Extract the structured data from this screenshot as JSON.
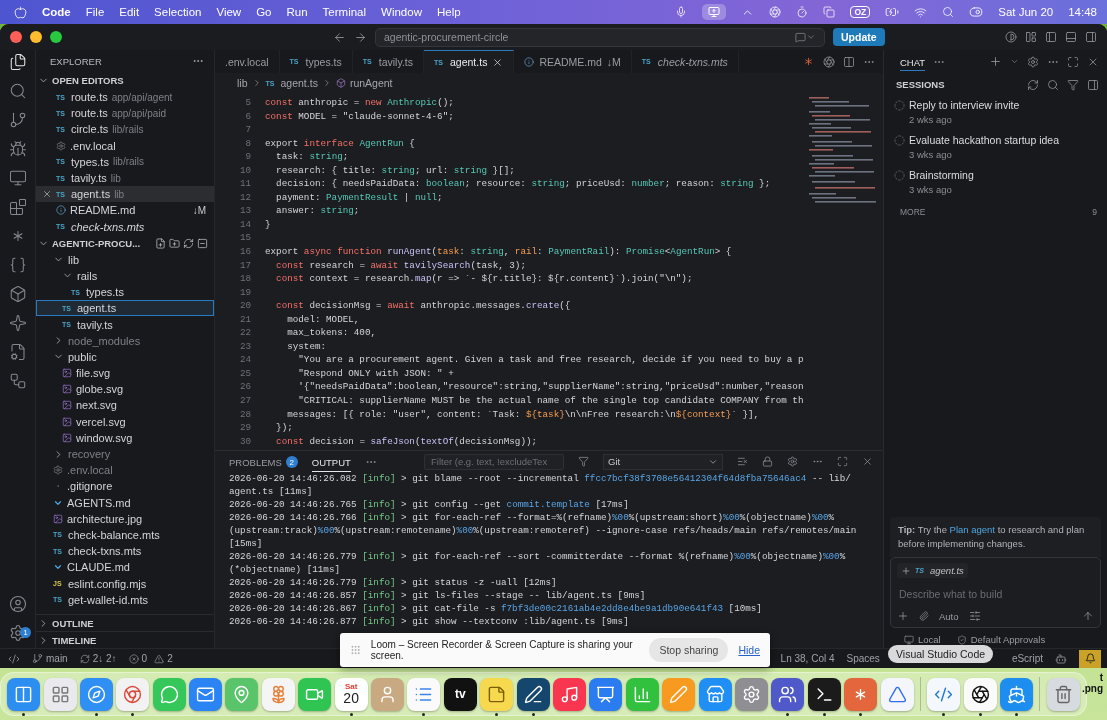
{
  "menubar": {
    "app": "Code",
    "menus": [
      "File",
      "Edit",
      "Selection",
      "View",
      "Go",
      "Run",
      "Terminal",
      "Window",
      "Help"
    ],
    "status_badge": "OZ",
    "date": "Sat Jun 20",
    "time": "14:48"
  },
  "titlebar": {
    "search": "agentic-procurement-circle",
    "update_button": "Update"
  },
  "activity_bar": {
    "items": [
      {
        "kind": "files",
        "selected": true
      },
      {
        "kind": "search",
        "selected": false
      },
      {
        "kind": "branch",
        "selected": false
      },
      {
        "kind": "bug",
        "selected": false
      },
      {
        "kind": "monitor",
        "selected": false
      },
      {
        "kind": "blocks",
        "selected": false
      },
      {
        "kind": "asterisk",
        "selected": false
      },
      {
        "kind": "braces",
        "selected": false
      },
      {
        "kind": "box",
        "selected": false
      },
      {
        "kind": "sparkle",
        "selected": false
      },
      {
        "kind": "filegear",
        "selected": false
      },
      {
        "kind": "workflow",
        "selected": false
      }
    ],
    "settings_badge": "1"
  },
  "explorer": {
    "title": "EXPLORER",
    "open_editors_title": "OPEN EDITORS",
    "open_editors": [
      {
        "kind": "ts",
        "icon_text": "TS",
        "name": "route.ts",
        "path": "app/api/agent",
        "italic": false,
        "selected": false
      },
      {
        "kind": "ts",
        "icon_text": "TS",
        "name": "route.ts",
        "path": "app/api/paid",
        "italic": false,
        "selected": false
      },
      {
        "kind": "ts",
        "icon_text": "TS",
        "name": "circle.ts",
        "path": "lib/rails",
        "italic": false,
        "selected": false
      },
      {
        "kind": "gear",
        "name": ".env.local",
        "italic": false,
        "selected": false
      },
      {
        "kind": "ts",
        "icon_text": "TS",
        "name": "types.ts",
        "path": "lib/rails",
        "italic": false,
        "selected": false
      },
      {
        "kind": "ts",
        "icon_text": "TS",
        "name": "tavily.ts",
        "path": "lib",
        "italic": false,
        "selected": false
      },
      {
        "kind": "ts",
        "icon_text": "TS",
        "name": "agent.ts",
        "path": "lib",
        "italic": false,
        "selected": true
      },
      {
        "kind": "info",
        "name": "README.md",
        "badge": "↓M",
        "italic": false,
        "selected": false
      },
      {
        "kind": "ts",
        "icon_text": "TS",
        "name": "check-txns.mts",
        "italic": true,
        "selected": false
      }
    ],
    "project_title": "AGENTIC-PROCU...",
    "tree": [
      {
        "kind": "folder",
        "name": "lib",
        "expanded": true,
        "dimmed": false,
        "selected": false,
        "children": [
          {
            "kind": "folder",
            "name": "rails",
            "expanded": true,
            "dimmed": false,
            "selected": false,
            "children": [
              {
                "kind": "ts",
                "icon_text": "TS",
                "name": "types.ts",
                "dimmed": false,
                "selected": false
              }
            ]
          },
          {
            "kind": "ts",
            "icon_text": "TS",
            "name": "agent.ts",
            "dimmed": false,
            "selected": true
          },
          {
            "kind": "ts",
            "icon_text": "TS",
            "name": "tavily.ts",
            "dimmed": false,
            "selected": false
          }
        ]
      },
      {
        "kind": "folder",
        "name": "node_modules",
        "expanded": false,
        "dimmed": true,
        "selected": false
      },
      {
        "kind": "folder",
        "name": "public",
        "expanded": true,
        "dimmed": false,
        "selected": false,
        "children": [
          {
            "kind": "svg",
            "name": "file.svg",
            "dimmed": false,
            "selected": false
          },
          {
            "kind": "svg",
            "name": "globe.svg",
            "dimmed": false,
            "selected": false
          },
          {
            "kind": "svg",
            "name": "next.svg",
            "dimmed": false,
            "selected": false
          },
          {
            "kind": "svg",
            "name": "vercel.svg",
            "dimmed": false,
            "selected": false
          },
          {
            "kind": "svg",
            "name": "window.svg",
            "dimmed": false,
            "selected": false
          }
        ]
      },
      {
        "kind": "folder",
        "name": "recovery",
        "expanded": false,
        "dimmed": true,
        "selected": false
      },
      {
        "kind": "gear",
        "name": ".env.local",
        "dimmed": true,
        "selected": false
      },
      {
        "kind": "git",
        "name": ".gitignore",
        "dimmed": false,
        "selected": false
      },
      {
        "kind": "md",
        "name": "AGENTS.md",
        "dimmed": false,
        "selected": false
      },
      {
        "kind": "image",
        "name": "architecture.jpg",
        "dimmed": false,
        "selected": false
      },
      {
        "kind": "ts",
        "icon_text": "TS",
        "name": "check-balance.mts",
        "dimmed": false,
        "selected": false
      },
      {
        "kind": "ts",
        "icon_text": "TS",
        "name": "check-txns.mts",
        "dimmed": false,
        "selected": false
      },
      {
        "kind": "md",
        "name": "CLAUDE.md",
        "dimmed": false,
        "selected": false
      },
      {
        "kind": "js",
        "icon_text": "JS",
        "name": "eslint.config.mjs",
        "dimmed": false,
        "selected": false
      },
      {
        "kind": "ts",
        "icon_text": "TS",
        "name": "get-wallet-id.mts",
        "dimmed": false,
        "selected": false
      }
    ],
    "sections": [
      "OUTLINE",
      "TIMELINE"
    ]
  },
  "tabs": [
    {
      "kind": "none",
      "label": ".env.local",
      "italic": false,
      "selected": false
    },
    {
      "kind": "ts",
      "icon_text": "TS",
      "label": "types.ts",
      "italic": false,
      "selected": false
    },
    {
      "kind": "ts",
      "icon_text": "TS",
      "label": "tavily.ts",
      "italic": false,
      "selected": false
    },
    {
      "kind": "ts",
      "icon_text": "TS",
      "label": "agent.ts",
      "italic": false,
      "selected": true
    },
    {
      "kind": "info",
      "label": "README.md",
      "badge": "↓M",
      "italic": false,
      "selected": false
    },
    {
      "kind": "ts",
      "icon_text": "TS",
      "label": "check-txns.mts",
      "italic": true,
      "selected": false
    }
  ],
  "breadcrumb": {
    "folder": "lib",
    "file_icon_text": "TS",
    "file": "agent.ts",
    "symbol": "runAgent"
  },
  "code": [
    {
      "number": "5",
      "segments": [
        {
          "kind": "kw",
          "text": "const "
        },
        {
          "kind": "x",
          "text": "anthropic = "
        },
        {
          "kind": "kw",
          "text": "new "
        },
        {
          "kind": "type",
          "text": "Anthropic"
        },
        {
          "kind": "x",
          "text": "();"
        }
      ]
    },
    {
      "number": "6",
      "segments": [
        {
          "kind": "kw",
          "text": "const "
        },
        {
          "kind": "x",
          "text": "MODEL = \"claude-sonnet-4-6\";"
        }
      ]
    },
    {
      "number": "7"
    },
    {
      "number": "8",
      "segments": [
        {
          "kind": "x",
          "text": "export "
        },
        {
          "kind": "kw",
          "text": "interface "
        },
        {
          "kind": "type",
          "text": "AgentRun"
        },
        {
          "kind": "x",
          "text": " {"
        }
      ]
    },
    {
      "number": "9",
      "segments": [
        {
          "kind": "x",
          "text": "  task: "
        },
        {
          "kind": "type",
          "text": "string"
        },
        {
          "kind": "x",
          "text": ";"
        }
      ]
    },
    {
      "number": "10",
      "segments": [
        {
          "kind": "x",
          "text": "  research: { title: "
        },
        {
          "kind": "type",
          "text": "string"
        },
        {
          "kind": "x",
          "text": "; url: "
        },
        {
          "kind": "type",
          "text": "string"
        },
        {
          "kind": "x",
          "text": " }[];"
        }
      ]
    },
    {
      "number": "11",
      "segments": [
        {
          "kind": "x",
          "text": "  decision: { needsPaidData: "
        },
        {
          "kind": "type",
          "text": "boolean"
        },
        {
          "kind": "x",
          "text": "; resource: "
        },
        {
          "kind": "type",
          "text": "string"
        },
        {
          "kind": "x",
          "text": "; priceUsd: "
        },
        {
          "kind": "type",
          "text": "number"
        },
        {
          "kind": "x",
          "text": "; reason: "
        },
        {
          "kind": "type",
          "text": "string"
        },
        {
          "kind": "x",
          "text": " };"
        }
      ]
    },
    {
      "number": "12",
      "segments": [
        {
          "kind": "x",
          "text": "  payment: "
        },
        {
          "kind": "type",
          "text": "PaymentResult"
        },
        {
          "kind": "x",
          "text": " | "
        },
        {
          "kind": "type",
          "text": "null"
        },
        {
          "kind": "x",
          "text": ";"
        }
      ]
    },
    {
      "number": "13",
      "segments": [
        {
          "kind": "x",
          "text": "  answer: "
        },
        {
          "kind": "type",
          "text": "string"
        },
        {
          "kind": "x",
          "text": ";"
        }
      ]
    },
    {
      "number": "14",
      "segments": [
        {
          "kind": "x",
          "text": "}"
        }
      ]
    },
    {
      "number": "15"
    },
    {
      "number": "16",
      "segments": [
        {
          "kind": "x",
          "text": "export "
        },
        {
          "kind": "kw",
          "text": "async function "
        },
        {
          "kind": "fn",
          "text": "runAgent"
        },
        {
          "kind": "x",
          "text": "("
        },
        {
          "kind": "param",
          "text": "task"
        },
        {
          "kind": "x",
          "text": ": "
        },
        {
          "kind": "type",
          "text": "string"
        },
        {
          "kind": "x",
          "text": ", "
        },
        {
          "kind": "param",
          "text": "rail"
        },
        {
          "kind": "x",
          "text": ": "
        },
        {
          "kind": "type",
          "text": "PaymentRail"
        },
        {
          "kind": "x",
          "text": "): "
        },
        {
          "kind": "type",
          "text": "Promise"
        },
        {
          "kind": "x",
          "text": "<"
        },
        {
          "kind": "type",
          "text": "AgentRun"
        },
        {
          "kind": "x",
          "text": "> {"
        }
      ]
    },
    {
      "number": "17",
      "segments": [
        {
          "kind": "kw",
          "text": "  const "
        },
        {
          "kind": "x",
          "text": "research = "
        },
        {
          "kind": "kw",
          "text": "await "
        },
        {
          "kind": "fn",
          "text": "tavilySearch"
        },
        {
          "kind": "x",
          "text": "(task, 3);"
        }
      ]
    },
    {
      "number": "18",
      "segments": [
        {
          "kind": "kw",
          "text": "  const "
        },
        {
          "kind": "x",
          "text": "context = research."
        },
        {
          "kind": "fn",
          "text": "map"
        },
        {
          "kind": "x",
          "text": "(r => `- ${r.title}: ${r.content}`).join(\"\\n\");"
        }
      ]
    },
    {
      "number": "19"
    },
    {
      "number": "20",
      "segments": [
        {
          "kind": "kw",
          "text": "  const "
        },
        {
          "kind": "x",
          "text": "decisionMsg = "
        },
        {
          "kind": "kw",
          "text": "await "
        },
        {
          "kind": "x",
          "text": "anthropic.messages."
        },
        {
          "kind": "fn",
          "text": "create"
        },
        {
          "kind": "x",
          "text": "({"
        }
      ]
    },
    {
      "number": "21",
      "segments": [
        {
          "kind": "x",
          "text": "    model: MODEL,"
        }
      ]
    },
    {
      "number": "22",
      "segments": [
        {
          "kind": "x",
          "text": "    max_tokens: 400,"
        }
      ]
    },
    {
      "number": "23",
      "segments": [
        {
          "kind": "x",
          "text": "    system:"
        }
      ]
    },
    {
      "number": "24",
      "segments": [
        {
          "kind": "x",
          "text": "      \"You are a procurement agent. Given a task and free research, decide if you need to buy a p"
        }
      ]
    },
    {
      "number": "25",
      "segments": [
        {
          "kind": "x",
          "text": "      \"Respond ONLY with JSON: \" +"
        }
      ]
    },
    {
      "number": "26",
      "segments": [
        {
          "kind": "x",
          "text": "      '{\"needsPaidData\":boolean,\"resource\":string,\"supplierName\":string,\"priceUsd\":number,\"reason"
        }
      ]
    },
    {
      "number": "27",
      "segments": [
        {
          "kind": "x",
          "text": "      \"CRITICAL: supplierName MUST be the actual name of the single top candidate COMPANY from th"
        }
      ]
    },
    {
      "number": "28",
      "segments": [
        {
          "kind": "x",
          "text": "    messages: [{ role: \"user\", content: `Task: "
        },
        {
          "kind": "param",
          "text": "${task}"
        },
        {
          "kind": "x",
          "text": "\\n\\nFree research:\\n"
        },
        {
          "kind": "param",
          "text": "${context}"
        },
        {
          "kind": "x",
          "text": "` }],"
        }
      ]
    },
    {
      "number": "29",
      "segments": [
        {
          "kind": "x",
          "text": "  });"
        }
      ]
    },
    {
      "number": "30",
      "segments": [
        {
          "kind": "kw",
          "text": "  const "
        },
        {
          "kind": "x",
          "text": "decision = "
        },
        {
          "kind": "fn",
          "text": "safeJson"
        },
        {
          "kind": "x",
          "text": "("
        },
        {
          "kind": "fn",
          "text": "textOf"
        },
        {
          "kind": "x",
          "text": "(decisionMsg));"
        }
      ]
    }
  ],
  "panel": {
    "tabs": [
      {
        "label": "PROBLEMS",
        "badge": "2",
        "selected": false
      },
      {
        "label": "OUTPUT",
        "selected": true
      }
    ],
    "filter_placeholder": "Filter (e.g. text, !excludeTex",
    "channel": "Git",
    "lines": [
      [
        {
          "kind": "x",
          "text": "2026-06-20 14:46:26.082 "
        },
        {
          "kind": "info",
          "text": "[info]"
        },
        {
          "kind": "x",
          "text": " > git blame --root --incremental "
        },
        {
          "kind": "link",
          "text": "ffcc7bcf38f3708e56412304f64d8fba75646ac4"
        },
        {
          "kind": "x",
          "text": " -- lib/"
        }
      ],
      [
        {
          "kind": "x",
          "text": "agent.ts [11ms]"
        }
      ],
      [
        {
          "kind": "x",
          "text": "2026-06-20 14:46:26.765 "
        },
        {
          "kind": "info",
          "text": "[info]"
        },
        {
          "kind": "x",
          "text": " > git config --get "
        },
        {
          "kind": "link",
          "text": "commit.template"
        },
        {
          "kind": "x",
          "text": " [17ms]"
        }
      ],
      [
        {
          "kind": "x",
          "text": "2026-06-20 14:46:26.766 "
        },
        {
          "kind": "info",
          "text": "[info]"
        },
        {
          "kind": "x",
          "text": " > git for-each-ref --format=%(refname)"
        },
        {
          "kind": "link",
          "text": "%00"
        },
        {
          "kind": "x",
          "text": "%(upstream:short)"
        },
        {
          "kind": "link",
          "text": "%00"
        },
        {
          "kind": "x",
          "text": "%(objectname)"
        },
        {
          "kind": "link",
          "text": "%00"
        },
        {
          "kind": "x",
          "text": "%"
        }
      ],
      [
        {
          "kind": "x",
          "text": "(upstream:track)"
        },
        {
          "kind": "link",
          "text": "%00"
        },
        {
          "kind": "x",
          "text": "%(upstream:remotename)"
        },
        {
          "kind": "link",
          "text": "%00"
        },
        {
          "kind": "x",
          "text": "%(upstream:remoteref) --ignore-case refs/heads/main refs/remotes/main"
        }
      ],
      [
        {
          "kind": "x",
          "text": "[15ms]"
        }
      ],
      [
        {
          "kind": "x",
          "text": "2026-06-20 14:46:26.779 "
        },
        {
          "kind": "info",
          "text": "[info]"
        },
        {
          "kind": "x",
          "text": " > git for-each-ref --sort -committerdate --format %(refname)"
        },
        {
          "kind": "link",
          "text": "%00"
        },
        {
          "kind": "x",
          "text": "%(objectname)"
        },
        {
          "kind": "link",
          "text": "%00"
        },
        {
          "kind": "x",
          "text": "%"
        }
      ],
      [
        {
          "kind": "x",
          "text": "(*objectname) [11ms]"
        }
      ],
      [
        {
          "kind": "x",
          "text": "2026-06-20 14:46:26.779 "
        },
        {
          "kind": "info",
          "text": "[info]"
        },
        {
          "kind": "x",
          "text": " > git status -z -uall [12ms]"
        }
      ],
      [
        {
          "kind": "x",
          "text": "2026-06-20 14:46:26.857 "
        },
        {
          "kind": "info",
          "text": "[info]"
        },
        {
          "kind": "x",
          "text": " > git ls-files --stage -- lib/agent.ts [9ms]"
        }
      ],
      [
        {
          "kind": "x",
          "text": "2026-06-20 14:46:26.867 "
        },
        {
          "kind": "info",
          "text": "[info]"
        },
        {
          "kind": "x",
          "text": " > git cat-file -s "
        },
        {
          "kind": "link",
          "text": "f7bf3de00c2161ab4e2dd8e4be9a1db90e641f43"
        },
        {
          "kind": "x",
          "text": " [10ms]"
        }
      ],
      [
        {
          "kind": "x",
          "text": "2026-06-20 14:46:26.877 "
        },
        {
          "kind": "info",
          "text": "[info]"
        },
        {
          "kind": "x",
          "text": " > git show --textconv :lib/agent.ts [9ms]"
        }
      ]
    ]
  },
  "chat": {
    "tab": "CHAT",
    "sessions_title": "SESSIONS",
    "sessions": [
      {
        "title": "Reply to interview invite",
        "time": "2 wks ago"
      },
      {
        "title": "Evaluate hackathon startup idea",
        "time": "3 wks ago"
      },
      {
        "title": "Brainstorming",
        "time": "3 wks ago"
      }
    ],
    "more": "MORE",
    "more_count": "9",
    "tip": {
      "before": "**Tip:** Try the",
      "link": "Plan agent",
      "after": "to research and plan before implementing changes."
    },
    "attachment_icon_text": "TS",
    "attachment": "agent.ts",
    "placeholder": "Describe what to build",
    "mode": "Auto",
    "location": "Local",
    "approvals": "Default Approvals"
  },
  "status_bar": {
    "branch": "main",
    "sync": "2↓ 2↑",
    "errors": "0",
    "warnings": "2",
    "position": "Ln 38, Col 4",
    "spaces": "Spaces",
    "language": "eScript"
  },
  "loom": {
    "message": "Loom – Screen Recorder & Screen Capture is sharing your screen.",
    "stop_button": "Stop sharing",
    "hide_link": "Hide"
  },
  "tooltip": "Visual Studio Code",
  "desktop_file": {
    "lines": [
      "t",
      ".png"
    ]
  },
  "dock": [
    {
      "kind": "finder",
      "color": "#2b8ef0",
      "running": true
    },
    {
      "kind": "grid",
      "color": "#e9e9ee",
      "running": false
    },
    {
      "kind": "compass",
      "color": "#2f8ff5",
      "running": true
    },
    {
      "kind": "chrome",
      "color": "#f2f2f2",
      "running": true
    },
    {
      "kind": "chat",
      "color": "#35c759",
      "running": false
    },
    {
      "kind": "mail",
      "color": "#2a84f3",
      "running": false
    },
    {
      "kind": "map",
      "color": "#5ac46b",
      "running": false
    },
    {
      "kind": "flower",
      "color": "#f5f5f5",
      "running": false
    },
    {
      "kind": "video",
      "color": "#30c552",
      "running": false
    },
    {
      "kind": "calendar",
      "color": "#ffffff",
      "running": true,
      "weekday": "Sat",
      "day": "20"
    },
    {
      "kind": "person",
      "color": "#c9a981",
      "running": false
    },
    {
      "kind": "list",
      "color": "#fafafa",
      "running": true
    },
    {
      "kind": "tv",
      "color": "#111111",
      "running": false,
      "label": "tv"
    },
    {
      "kind": "note",
      "color": "#f7d950",
      "running": true
    },
    {
      "kind": "squiggle",
      "color": "#15476e",
      "running": true
    },
    {
      "kind": "music",
      "color": "#f9364f",
      "running": false
    },
    {
      "kind": "keynote",
      "color": "#2a7cf0",
      "running": false
    },
    {
      "kind": "chart",
      "color": "#32c03f",
      "running": false
    },
    {
      "kind": "pen",
      "color": "#f79a1f",
      "running": false
    },
    {
      "kind": "store",
      "color": "#1f8ef5",
      "running": false
    },
    {
      "kind": "gear",
      "color": "#8e8e93",
      "running": false
    },
    {
      "kind": "people",
      "color": "#5059c9",
      "running": true
    },
    {
      "kind": "terminal",
      "color": "#1b1b1b",
      "running": true
    },
    {
      "kind": "asterisk",
      "color": "#e4663d",
      "running": true
    },
    {
      "kind": "triangle",
      "color": "#f4f6fb",
      "running": false
    },
    {
      "kind": "code",
      "color": "#f4f7fb",
      "running": true,
      "separator": true
    },
    {
      "kind": "aperture",
      "color": "#fafafa",
      "running": true
    },
    {
      "kind": "ship",
      "color": "#1d8ef0",
      "running": true
    },
    {
      "kind": "trash",
      "color": "#d7dadf",
      "running": false,
      "separator": true
    }
  ]
}
